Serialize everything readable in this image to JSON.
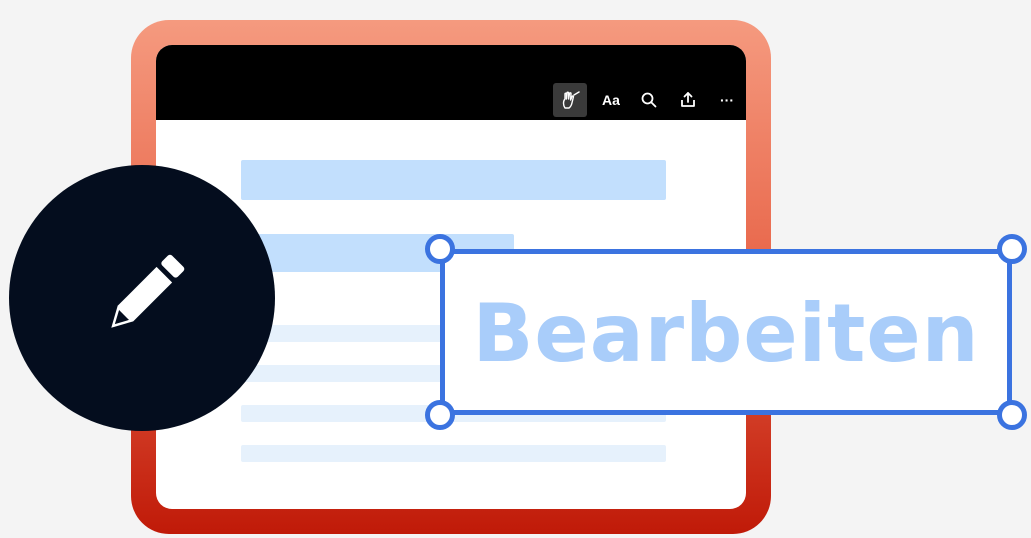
{
  "toolbar": {
    "items": [
      {
        "name": "draw-hand-icon",
        "active": true
      },
      {
        "name": "text-format",
        "label": "Aa"
      },
      {
        "name": "search-icon"
      },
      {
        "name": "share-icon"
      },
      {
        "name": "more-icon",
        "label": "···"
      }
    ]
  },
  "edit_box": {
    "text": "Bearbeiten"
  },
  "colors": {
    "frame_top": "#f59a7f",
    "frame_bottom": "#c01a08",
    "toolbar": "#000000",
    "highlight_line": "#c2dffd",
    "faint_line": "#e6f1fc",
    "selection": "#3b73e0",
    "edit_text": "#a9cdfa",
    "pen_circle": "#040d1e"
  }
}
